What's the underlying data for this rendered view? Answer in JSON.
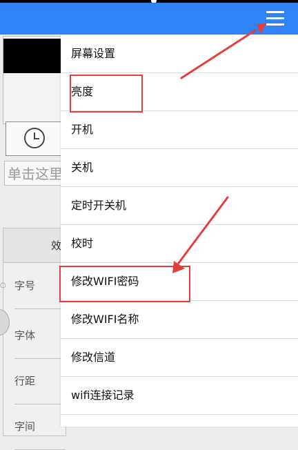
{
  "background": {
    "input_text": "单击这里",
    "table_header": "效",
    "table_rows": [
      "字号",
      "字体",
      "行距",
      "字间"
    ],
    "tiny_mark": "○"
  },
  "menu": {
    "items": [
      {
        "label": "屏幕设置"
      },
      {
        "label": "亮度"
      },
      {
        "label": "开机"
      },
      {
        "label": "关机"
      },
      {
        "label": "定时开关机"
      },
      {
        "label": "校时"
      },
      {
        "label": "修改WIFI密码"
      },
      {
        "label": "修改WIFI名称"
      },
      {
        "label": "修改信道"
      },
      {
        "label": "wifi连接记录"
      },
      {
        "label": ""
      }
    ]
  },
  "icons": {
    "menu": "hamburger-menu-icon",
    "clock": "clock-icon"
  },
  "colors": {
    "topbar": "#2f83f4",
    "annotation": "#e53c3c"
  }
}
